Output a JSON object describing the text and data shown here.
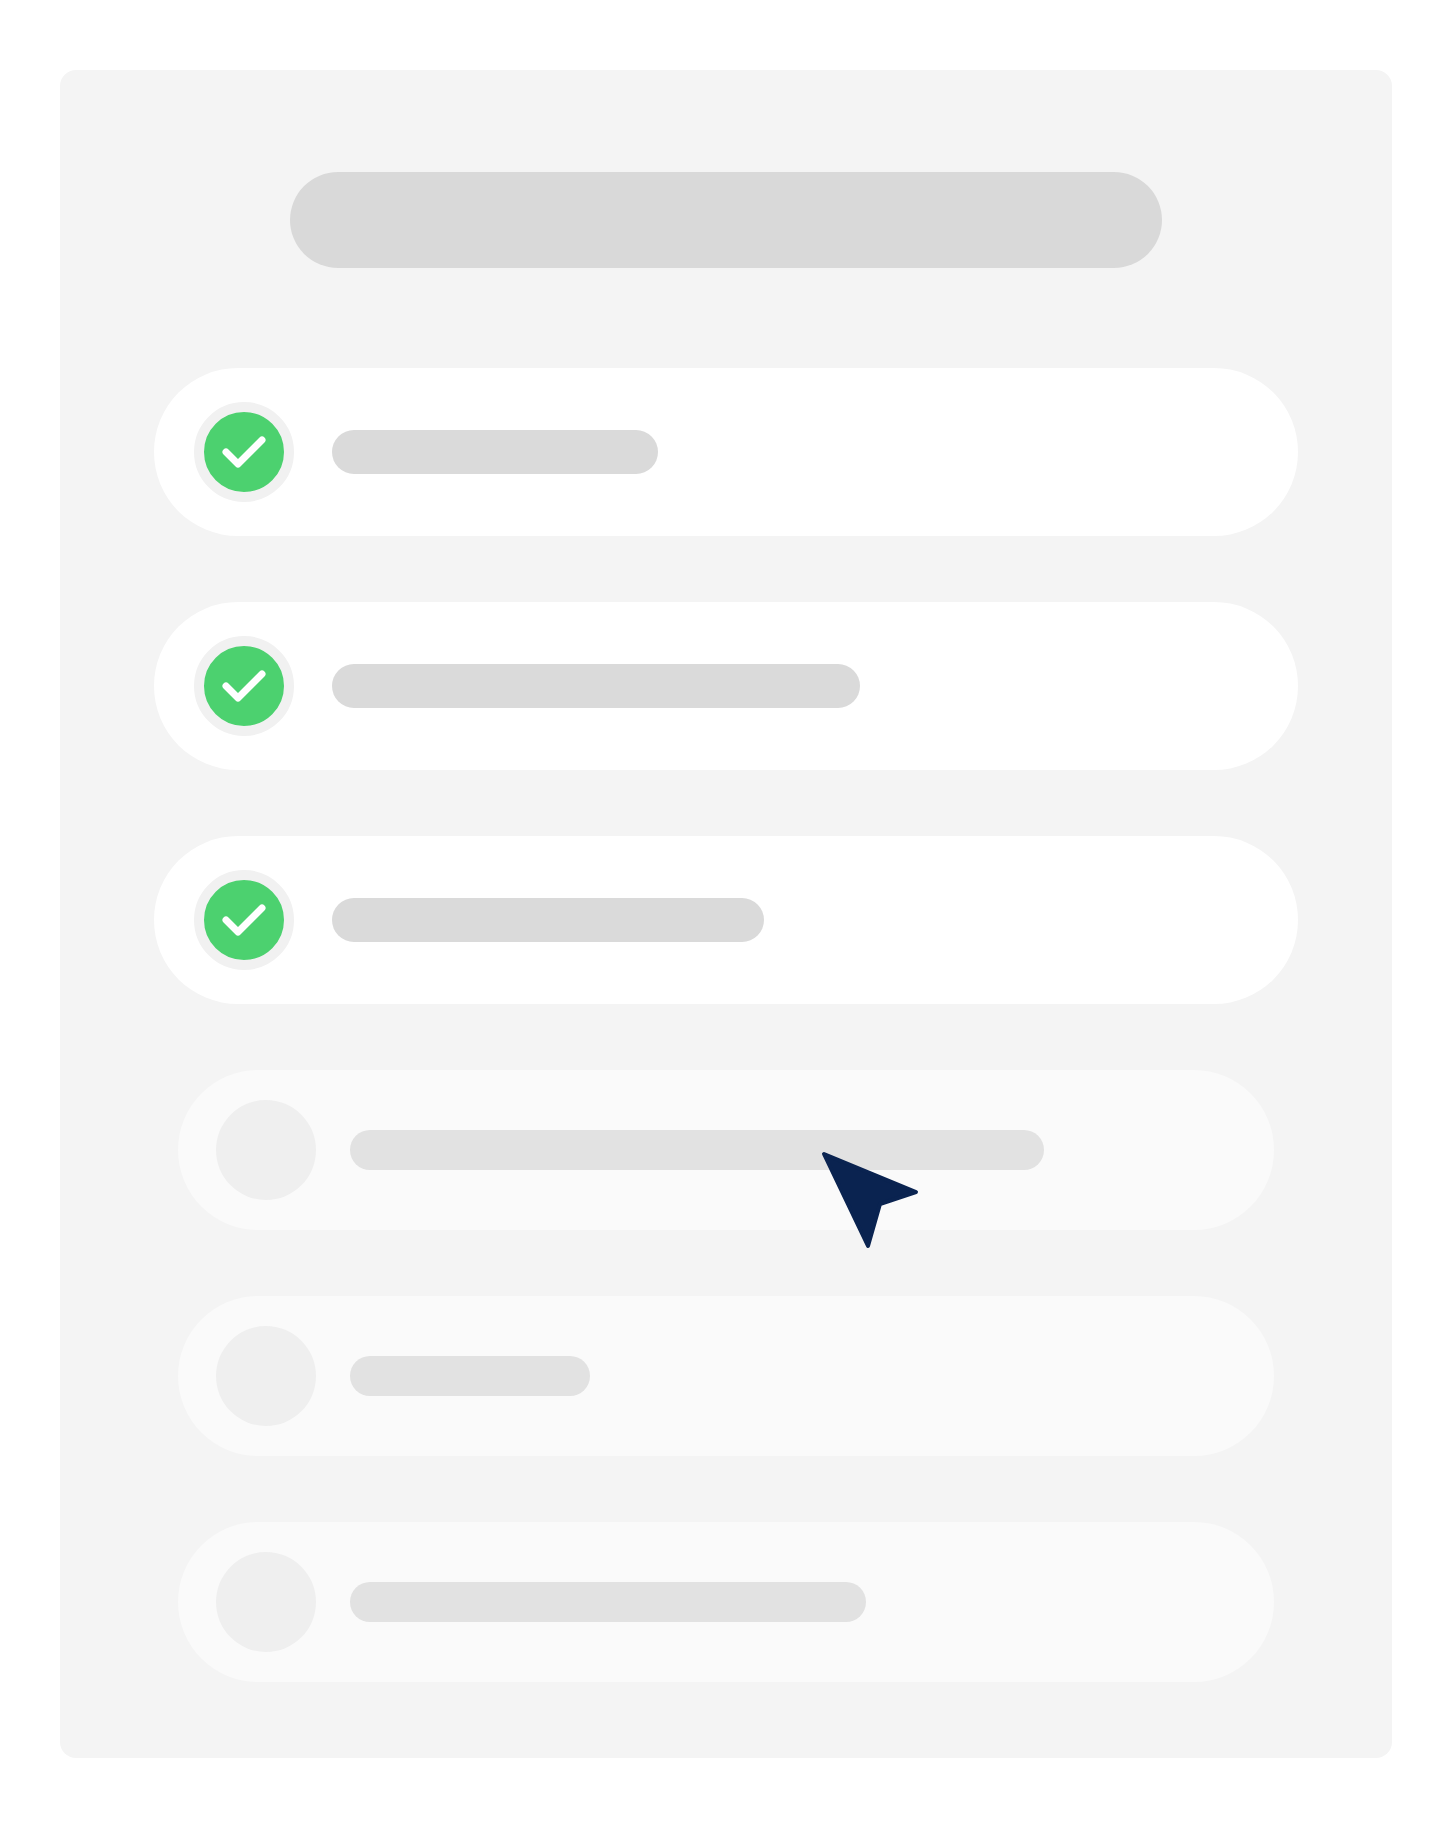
{
  "checklist": {
    "items": [
      {
        "checked": true
      },
      {
        "checked": true
      },
      {
        "checked": true
      },
      {
        "checked": false
      },
      {
        "checked": false
      },
      {
        "checked": false
      }
    ]
  }
}
